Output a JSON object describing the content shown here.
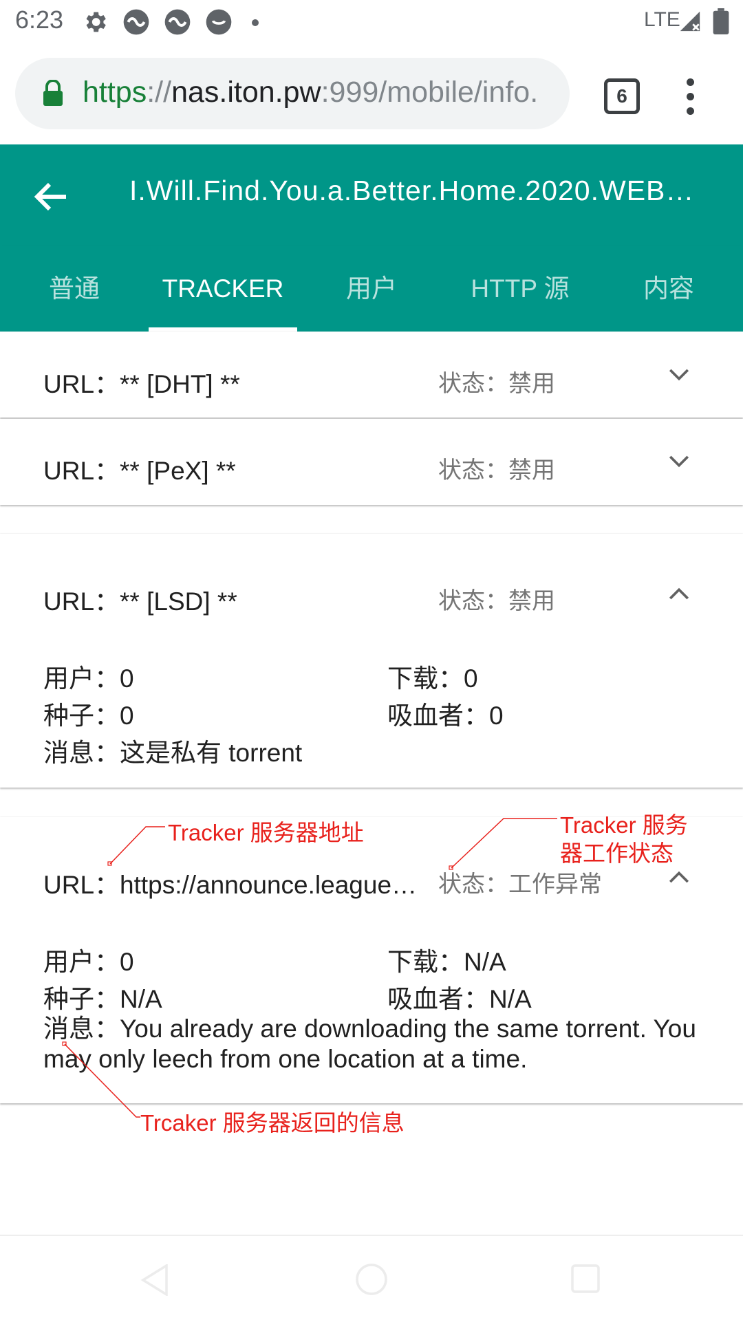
{
  "status_bar": {
    "time": "6:23",
    "network": "LTE"
  },
  "browser": {
    "url_scheme": "https",
    "url_sep": "://",
    "url_host": "nas.iton.pw",
    "url_rest": ":999/mobile/info.",
    "tab_count": "6"
  },
  "appbar": {
    "title": "I.Will.Find.You.a.Better.Home.2020.WEB…"
  },
  "tabs": [
    {
      "label": "普通"
    },
    {
      "label": "TRACKER"
    },
    {
      "label": "用户"
    },
    {
      "label": "HTTP 源"
    },
    {
      "label": "内容"
    }
  ],
  "trackers": [
    {
      "url_label": "URL：",
      "url": "** [DHT] **",
      "state_label": "状态：",
      "state": "禁用",
      "expanded": false
    },
    {
      "url_label": "URL：",
      "url": "** [PeX] **",
      "state_label": "状态：",
      "state": "禁用",
      "expanded": false
    },
    {
      "url_label": "URL：",
      "url": "** [LSD] **",
      "state_label": "状态：",
      "state": "禁用",
      "expanded": true,
      "users_label": "用户：",
      "users": "0",
      "downloads_label": "下载：",
      "downloads": "0",
      "seeds_label": "种子：",
      "seeds": "0",
      "leechers_label": "吸血者：",
      "leechers": "0",
      "msg_label": "消息：",
      "msg": "这是私有 torrent"
    },
    {
      "url_label": "URL：",
      "url": "https://announce.league…",
      "state_label": "状态：",
      "state": "工作异常",
      "expanded": true,
      "users_label": "用户：",
      "users": "0",
      "downloads_label": "下载：",
      "downloads": "N/A",
      "seeds_label": "种子：",
      "seeds": "N/A",
      "leechers_label": "吸血者：",
      "leechers": "N/A",
      "msg_label": "消息：",
      "msg": "You already are downloading the same torrent. You may only leech from one location at a time."
    }
  ],
  "annotations": {
    "address": "Tracker 服务器地址",
    "status_line1": "Tracker 服务",
    "status_line2": "器工作状态",
    "message": "Trcaker 服务器返回的信息"
  },
  "colors": {
    "primary": "#009688",
    "annotation": "#e8211c",
    "secure": "#188038"
  }
}
